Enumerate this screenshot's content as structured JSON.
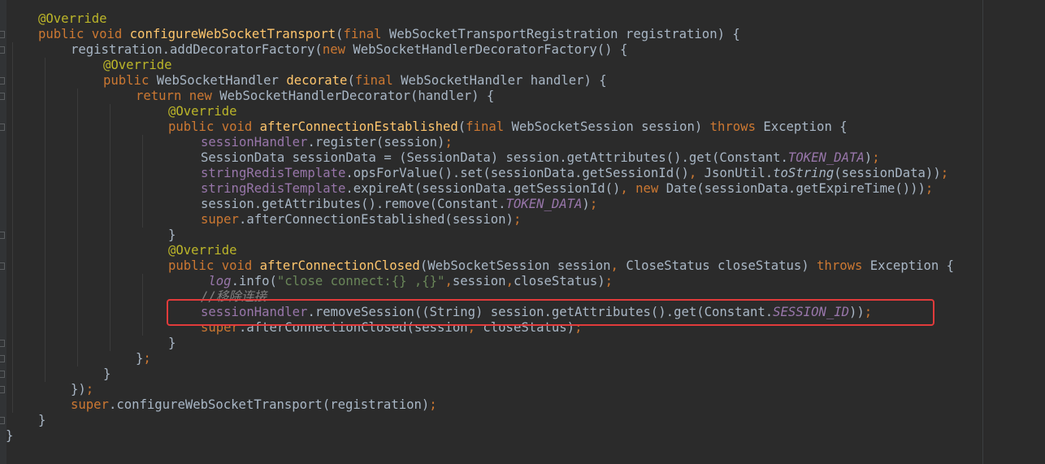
{
  "editor": {
    "language": "java",
    "colors": {
      "background": "#2b2b2b",
      "text": "#a9b7c6",
      "keyword": "#cc7832",
      "annotation": "#bbb529",
      "method_declaration": "#ffc66d",
      "field": "#9876aa",
      "string": "#6a8759",
      "comment": "#808080",
      "highlight_box": "#e13b3b"
    },
    "lines": [
      {
        "indent": 1,
        "tokens": [
          [
            "a",
            "@Override"
          ]
        ]
      },
      {
        "indent": 1,
        "tokens": [
          [
            "k",
            "public void "
          ],
          [
            "f",
            "configureWebSocketTransport"
          ],
          [
            "p",
            "("
          ],
          [
            "k",
            "final "
          ],
          [
            "p",
            "WebSocketTransportRegistration registration) {"
          ]
        ]
      },
      {
        "indent": 2,
        "tokens": [
          [
            "p",
            "registration.addDecoratorFactory("
          ],
          [
            "k",
            "new "
          ],
          [
            "p",
            "WebSocketHandlerDecoratorFactory() {"
          ]
        ]
      },
      {
        "indent": 3,
        "tokens": [
          [
            "a",
            "@Override"
          ]
        ]
      },
      {
        "indent": 3,
        "tokens": [
          [
            "k",
            "public "
          ],
          [
            "p",
            "WebSocketHandler "
          ],
          [
            "f",
            "decorate"
          ],
          [
            "p",
            "("
          ],
          [
            "k",
            "final "
          ],
          [
            "p",
            "WebSocketHandler handler) {"
          ]
        ]
      },
      {
        "indent": 4,
        "tokens": [
          [
            "k",
            "return new "
          ],
          [
            "p",
            "WebSocketHandlerDecorator(handler) {"
          ]
        ]
      },
      {
        "indent": 5,
        "tokens": [
          [
            "a",
            "@Override"
          ]
        ]
      },
      {
        "indent": 5,
        "tokens": [
          [
            "k",
            "public void "
          ],
          [
            "f",
            "afterConnectionEstablished"
          ],
          [
            "p",
            "("
          ],
          [
            "k",
            "final "
          ],
          [
            "p",
            "WebSocketSession session) "
          ],
          [
            "k",
            "throws "
          ],
          [
            "p",
            "Exception {"
          ]
        ]
      },
      {
        "indent": 6,
        "tokens": [
          [
            "i",
            "sessionHandler"
          ],
          [
            "p",
            ".register(session)"
          ],
          [
            "k",
            ";"
          ]
        ]
      },
      {
        "indent": 6,
        "tokens": [
          [
            "p",
            "SessionData sessionData = (SessionData) session.getAttributes().get(Constant."
          ],
          [
            "c",
            "TOKEN_DATA"
          ],
          [
            "p",
            ")"
          ],
          [
            "k",
            ";"
          ]
        ]
      },
      {
        "indent": 6,
        "tokens": [
          [
            "i",
            "stringRedisTemplate"
          ],
          [
            "p",
            ".opsForValue().set(sessionData.getSessionId()"
          ],
          [
            "k",
            ", "
          ],
          [
            "p",
            "JsonUtil."
          ],
          [
            "t",
            "toString"
          ],
          [
            "p",
            "(sessionData))"
          ],
          [
            "k",
            ";"
          ]
        ]
      },
      {
        "indent": 6,
        "tokens": [
          [
            "i",
            "stringRedisTemplate"
          ],
          [
            "p",
            ".expireAt(sessionData.getSessionId()"
          ],
          [
            "k",
            ", new "
          ],
          [
            "p",
            "Date(sessionData.getExpireTime()))"
          ],
          [
            "k",
            ";"
          ]
        ]
      },
      {
        "indent": 6,
        "tokens": [
          [
            "p",
            "session.getAttributes().remove(Constant."
          ],
          [
            "c",
            "TOKEN_DATA"
          ],
          [
            "p",
            ")"
          ],
          [
            "k",
            ";"
          ]
        ]
      },
      {
        "indent": 6,
        "tokens": [
          [
            "k",
            "super"
          ],
          [
            "p",
            ".afterConnectionEstablished(session)"
          ],
          [
            "k",
            ";"
          ]
        ]
      },
      {
        "indent": 5,
        "tokens": [
          [
            "p",
            "}"
          ]
        ]
      },
      {
        "indent": 5,
        "tokens": [
          [
            "a",
            "@Override"
          ]
        ]
      },
      {
        "indent": 5,
        "tokens": [
          [
            "k",
            "public void "
          ],
          [
            "f",
            "afterConnectionClosed"
          ],
          [
            "p",
            "(WebSocketSession session"
          ],
          [
            "k",
            ", "
          ],
          [
            "p",
            "CloseStatus closeStatus) "
          ],
          [
            "k",
            "throws "
          ],
          [
            "p",
            "Exception {"
          ]
        ]
      },
      {
        "indent": 6,
        "tokens": [
          [
            "p",
            " "
          ],
          [
            "l",
            "log"
          ],
          [
            "p",
            ".info("
          ],
          [
            "s",
            "\"close connect:{} ,{}\""
          ],
          [
            "k",
            ","
          ],
          [
            "p",
            "session"
          ],
          [
            "k",
            ","
          ],
          [
            "p",
            "closeStatus)"
          ],
          [
            "k",
            ";"
          ]
        ]
      },
      {
        "indent": 6,
        "tokens": [
          [
            "m",
            "//移除连接"
          ]
        ]
      },
      {
        "indent": 6,
        "tokens": [
          [
            "i",
            "sessionHandler"
          ],
          [
            "p",
            ".removeSession((String) session.getAttributes().get(Constant."
          ],
          [
            "c",
            "SESSION_ID"
          ],
          [
            "p",
            "))"
          ],
          [
            "k",
            ";"
          ]
        ]
      },
      {
        "indent": 6,
        "tokens": [
          [
            "k",
            "super"
          ],
          [
            "p",
            ".afterConnectionClosed(session"
          ],
          [
            "k",
            ", "
          ],
          [
            "p",
            "closeStatus)"
          ],
          [
            "k",
            ";"
          ]
        ]
      },
      {
        "indent": 5,
        "tokens": [
          [
            "p",
            "}"
          ]
        ]
      },
      {
        "indent": 4,
        "tokens": [
          [
            "p",
            "}"
          ],
          [
            "k",
            ";"
          ]
        ]
      },
      {
        "indent": 3,
        "tokens": [
          [
            "p",
            "}"
          ]
        ]
      },
      {
        "indent": 2,
        "tokens": [
          [
            "p",
            "})"
          ],
          [
            "k",
            ";"
          ]
        ]
      },
      {
        "indent": 2,
        "tokens": [
          [
            "k",
            "super"
          ],
          [
            "p",
            ".configureWebSocketTransport(registration)"
          ],
          [
            "k",
            ";"
          ]
        ]
      },
      {
        "indent": 1,
        "tokens": [
          [
            "p",
            "}"
          ]
        ]
      },
      {
        "indent": 0,
        "tokens": [
          [
            "p",
            "}"
          ]
        ]
      }
    ],
    "highlighted_line_index": 19
  }
}
